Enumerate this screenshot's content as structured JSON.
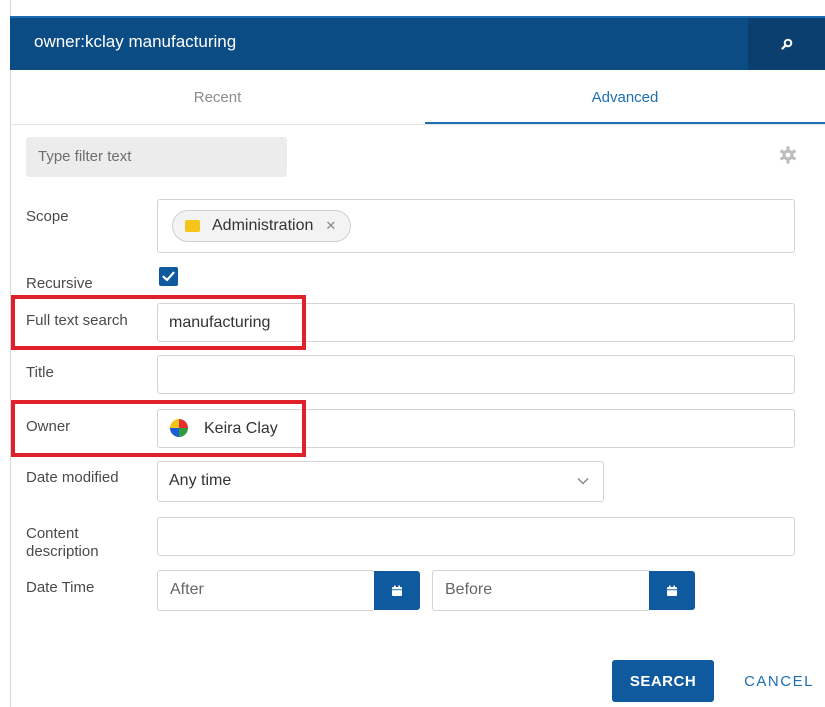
{
  "search_bar": {
    "query": "owner:kclay manufacturing",
    "icon": "search-icon"
  },
  "tabs": [
    {
      "label": "Recent",
      "active": false
    },
    {
      "label": "Advanced",
      "active": true
    }
  ],
  "filter": {
    "placeholder": "Type filter text"
  },
  "fields": {
    "scope": {
      "label": "Scope",
      "chip": "Administration"
    },
    "recursive": {
      "label": "Recursive",
      "checked": true
    },
    "full_text": {
      "label": "Full text search",
      "value": "manufacturing"
    },
    "title": {
      "label": "Title",
      "value": ""
    },
    "owner": {
      "label": "Owner",
      "value": "Keira Clay"
    },
    "date_modified": {
      "label": "Date modified",
      "value": "Any time"
    },
    "content_description": {
      "label_line1": "Content",
      "label_line2": "description",
      "value": ""
    },
    "date_time": {
      "label": "Date Time",
      "after_placeholder": "After",
      "before_placeholder": "Before"
    }
  },
  "actions": {
    "search": "SEARCH",
    "cancel": "CANCEL"
  },
  "colors": {
    "primary": "#0f5a9e",
    "topbar": "#0b4c85",
    "highlight": "#e0202b",
    "folder": "#f5c518"
  }
}
